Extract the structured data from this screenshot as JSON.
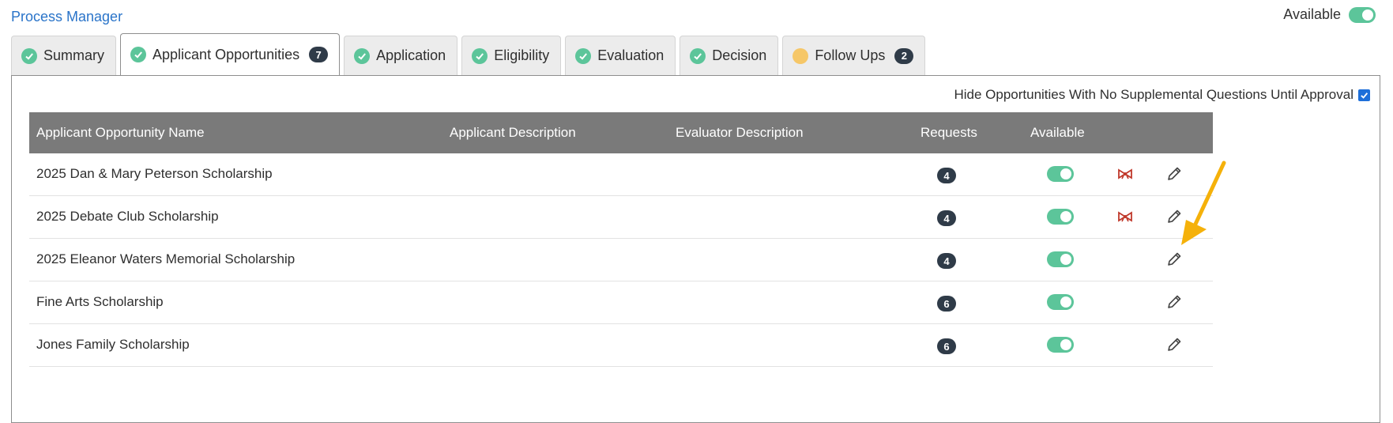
{
  "header": {
    "title": "Process Manager",
    "available_label": "Available",
    "available_on": true
  },
  "tabs": [
    {
      "label": "Summary",
      "status": "complete"
    },
    {
      "label": "Applicant Opportunities",
      "status": "complete",
      "badge": "7",
      "active": true
    },
    {
      "label": "Application",
      "status": "complete"
    },
    {
      "label": "Eligibility",
      "status": "complete"
    },
    {
      "label": "Evaluation",
      "status": "complete"
    },
    {
      "label": "Decision",
      "status": "complete"
    },
    {
      "label": "Follow Ups",
      "status": "pending",
      "badge": "2"
    }
  ],
  "options": {
    "hide_no_supplemental_label": "Hide Opportunities With No Supplemental Questions Until Approval",
    "hide_no_supplemental_checked": true
  },
  "table": {
    "columns": [
      "Applicant Opportunity Name",
      "Applicant Description",
      "Evaluator Description",
      "Requests",
      "Available"
    ],
    "rows": [
      {
        "name": "2025 Dan & Mary Peterson Scholarship",
        "requests": "4",
        "available": true,
        "ribbon": true
      },
      {
        "name": "2025 Debate Club Scholarship",
        "requests": "4",
        "available": true,
        "ribbon": true
      },
      {
        "name": "2025 Eleanor Waters Memorial Scholarship",
        "requests": "4",
        "available": true,
        "ribbon": false
      },
      {
        "name": "Fine Arts Scholarship",
        "requests": "6",
        "available": true,
        "ribbon": false
      },
      {
        "name": "Jones Family Scholarship",
        "requests": "6",
        "available": true,
        "ribbon": false
      }
    ]
  },
  "colors": {
    "accent_green": "#5cc59a",
    "link_blue": "#2a74c9",
    "header_gray": "#7a7a7a",
    "badge_dark": "#2f3b48",
    "annotation_arrow": "#f5b10a",
    "ribbon_red": "#c0392b"
  }
}
